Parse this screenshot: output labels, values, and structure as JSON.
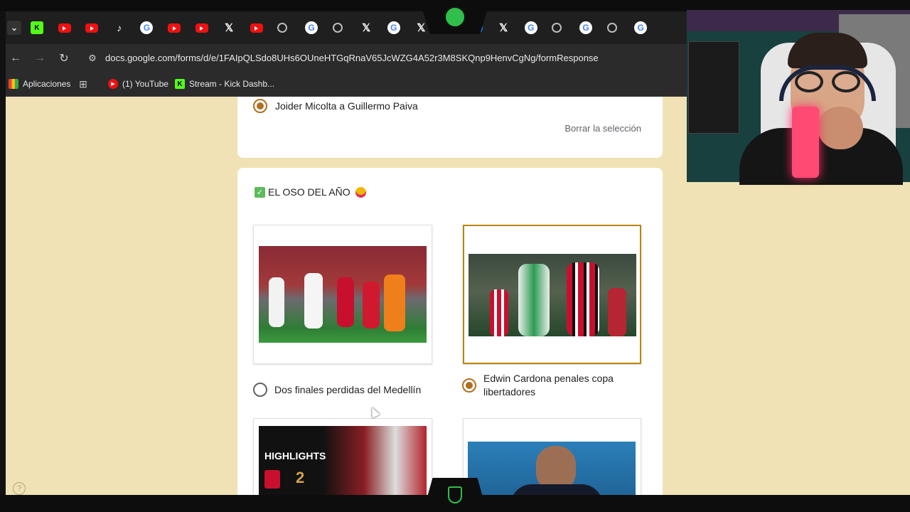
{
  "browser": {
    "url": "docs.google.com/forms/d/e/1FAIpQLSdo8UHs6OUneHTGqRnaV65JcWZG4A52r3M8SKQnp9HenvCgNg/formResponse",
    "tabs": [
      {
        "icon": "kick-icon",
        "glyph": "K"
      },
      {
        "icon": "youtube-icon",
        "glyph": ""
      },
      {
        "icon": "youtube-icon",
        "glyph": ""
      },
      {
        "icon": "tiktok-icon",
        "glyph": "♪"
      },
      {
        "icon": "google-icon",
        "glyph": "G"
      },
      {
        "icon": "youtube-icon",
        "glyph": ""
      },
      {
        "icon": "youtube-icon",
        "glyph": ""
      },
      {
        "icon": "x-icon",
        "glyph": "𝕏"
      },
      {
        "icon": "youtube-icon",
        "glyph": ""
      },
      {
        "icon": "chrome-icon",
        "glyph": ""
      },
      {
        "icon": "google-icon",
        "glyph": "G"
      },
      {
        "icon": "globe-icon",
        "glyph": ""
      },
      {
        "icon": "x-icon",
        "glyph": "𝕏"
      },
      {
        "icon": "google-icon",
        "glyph": "G"
      },
      {
        "icon": "x-icon",
        "glyph": "𝕏"
      },
      {
        "icon": "google-icon",
        "glyph": "G"
      },
      {
        "icon": "facebook-icon",
        "glyph": "f"
      },
      {
        "icon": "x-icon",
        "glyph": "𝕏"
      },
      {
        "icon": "google-icon",
        "glyph": "G"
      },
      {
        "icon": "globe-icon",
        "glyph": ""
      },
      {
        "icon": "google-icon",
        "glyph": "G"
      },
      {
        "icon": "globe-icon",
        "glyph": ""
      },
      {
        "icon": "google-icon",
        "glyph": "G"
      }
    ],
    "bookmarks": {
      "apps": "Aplicaciones",
      "youtube": "(1) YouTube",
      "kick": "Stream - Kick Dashb..."
    }
  },
  "form": {
    "prev_question": {
      "selected_option": "Joider Micolta a Guillermo Paiva",
      "clear_label": "Borrar la selección"
    },
    "question": {
      "title": "EL OSO DEL AÑO",
      "options": [
        {
          "label": "Dos finales perdidas del Medellín",
          "selected": false
        },
        {
          "label": "Edwin Cardona penales copa libertadores",
          "selected": true
        }
      ],
      "thumb_text": {
        "highlights": "HIGHLIGHTS",
        "score": "2"
      }
    }
  },
  "colors": {
    "form_bg": "#f0e2b4",
    "accent": "#b06f1e"
  }
}
